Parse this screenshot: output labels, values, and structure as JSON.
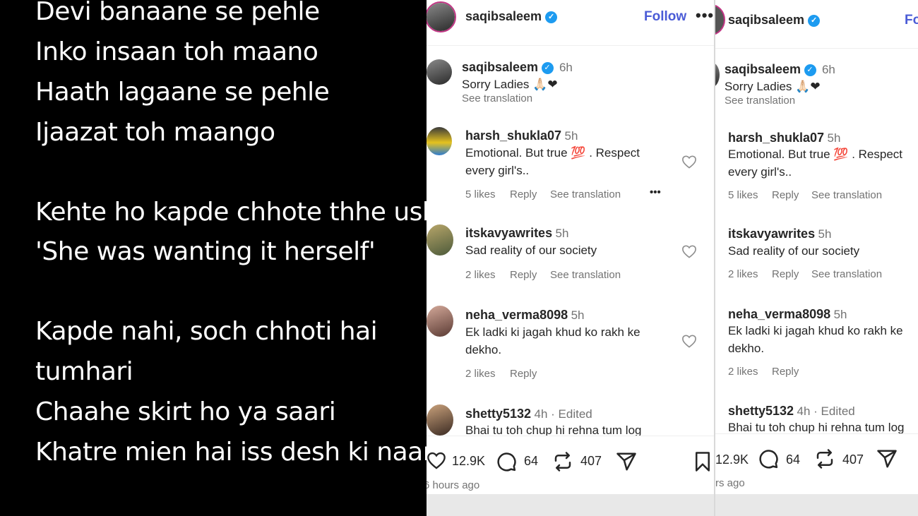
{
  "poem": {
    "lines": [
      "Devi banaane se pehle",
      "Inko insaan toh maano",
      "Haath lagaane se pehle",
      "Ijaazat toh maango",
      "Kehte ho kapde chhote thhe uske",
      "'She was wanting it herself'",
      "Kapde nahi, soch chhoti hai",
      "tumhari",
      "Chaahe skirt ho ya saari",
      "Khatre mien hai iss desh ki naari"
    ]
  },
  "post": {
    "username": "saqibsaleem",
    "follow_label": "Follow",
    "more_label": "•••",
    "caption": {
      "username": "saqibsaleem",
      "time": "6h",
      "text": "Sorry Ladies 🙏🏻❤",
      "see_translation": "See translation"
    },
    "comments": [
      {
        "username": "harsh_shukla07",
        "time": "5h",
        "text_line1": "Emotional. But true 💯 . Respect",
        "text_line2": "every girl's..",
        "likes": "5 likes",
        "reply": "Reply",
        "see_translation": "See translation",
        "more": "•••"
      },
      {
        "username": "itskavyawrites",
        "time": "5h",
        "text_line1": "Sad reality of our society",
        "likes": "2 likes",
        "reply": "Reply",
        "see_translation": "See translation"
      },
      {
        "username": "neha_verma8098",
        "time": "5h",
        "text_line1": "Ek ladki ki jagah khud ko rakh ke",
        "text_line2": "dekho.",
        "likes": "2 likes",
        "reply": "Reply"
      },
      {
        "username": "shetty5132",
        "time": "4h · Edited",
        "text_line1": "Bhai tu toh chup hi rehna tum log"
      }
    ],
    "stats": {
      "likes": "12.9K",
      "comments": "64",
      "reposts": "407"
    },
    "time_ago_p1": "6 hours ago",
    "time_ago_p2": "rs ago",
    "follow_partial": "Fo"
  },
  "colors": {
    "accent": "#4a5bd6",
    "verified": "#1d9bf0",
    "text": "#262626",
    "muted": "#737373"
  }
}
